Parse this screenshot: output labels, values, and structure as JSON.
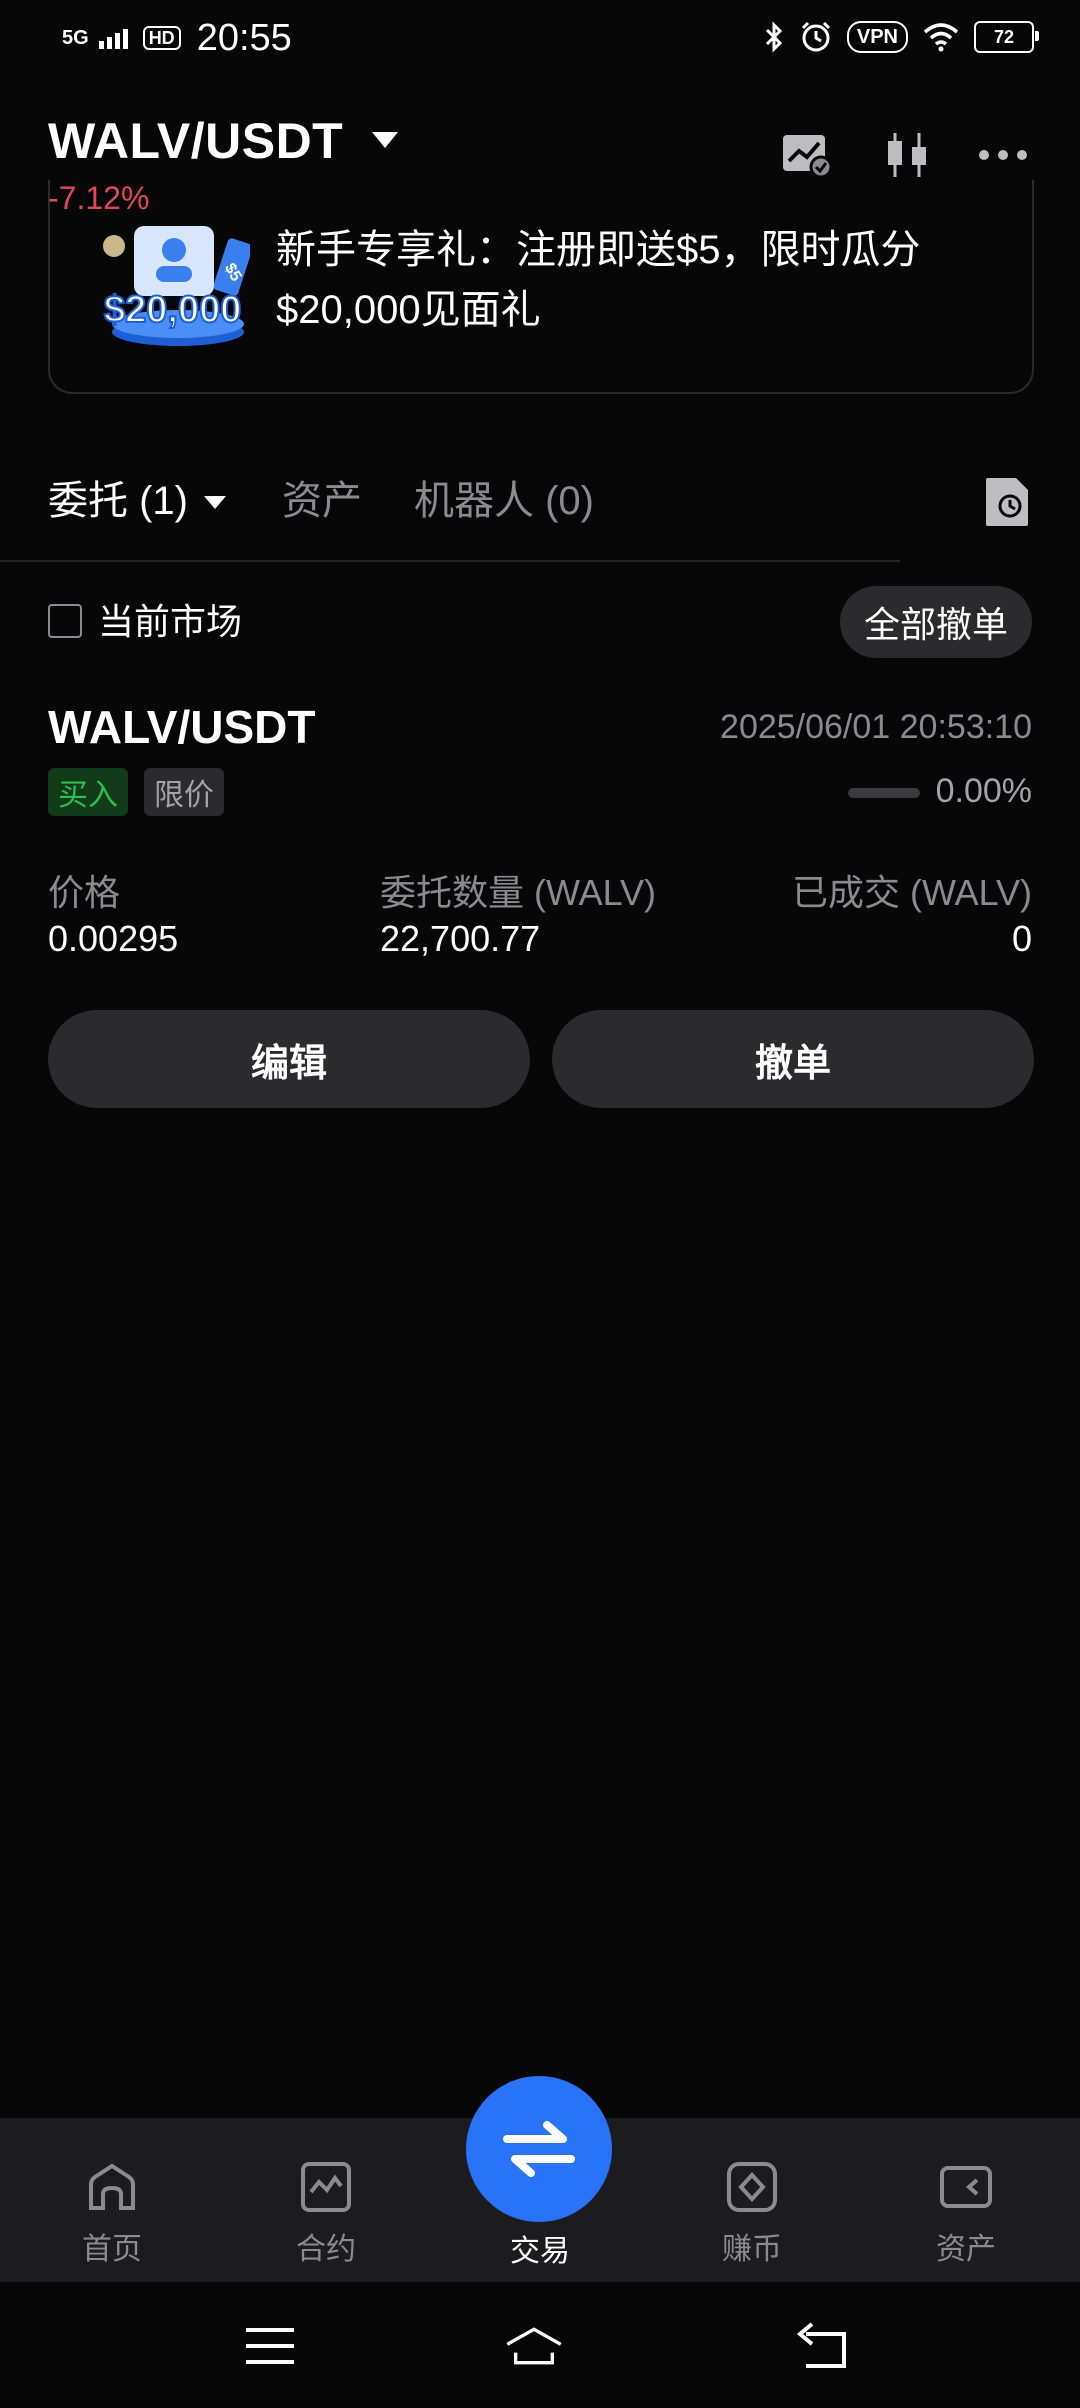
{
  "status_bar": {
    "signal": "5G",
    "hd": "HD",
    "time": "20:55",
    "vpn": "VPN",
    "battery": "72"
  },
  "header": {
    "pair": "WALV/USDT",
    "change": "-7.12%",
    "change_color": "#e0475b"
  },
  "banner": {
    "art_text": "$20,000",
    "ticket_text": "$5",
    "text": "新手专享礼：注册即送$5，限时瓜分$20,000见面礼"
  },
  "tabs": {
    "orders": "委托 (1)",
    "assets": "资产",
    "bots": "机器人 (0)"
  },
  "filter": {
    "current_market": "当前市场",
    "cancel_all": "全部撤单"
  },
  "order": {
    "pair": "WALV/USDT",
    "time": "2025/06/01 20:53:10",
    "side": "买入",
    "type": "限价",
    "filled_pct": "0.00%",
    "filled_fraction": 0,
    "price_label": "价格",
    "price": "0.00295",
    "qty_label": "委托数量 (WALV)",
    "qty": "22,700.77",
    "filled_label": "已成交 (WALV)",
    "filled": "0",
    "edit": "编辑",
    "cancel": "撤单"
  },
  "bottom_nav": {
    "home": "首页",
    "futures": "合约",
    "trade": "交易",
    "earn": "赚币",
    "assets": "资产",
    "accent": "#2873f7"
  }
}
